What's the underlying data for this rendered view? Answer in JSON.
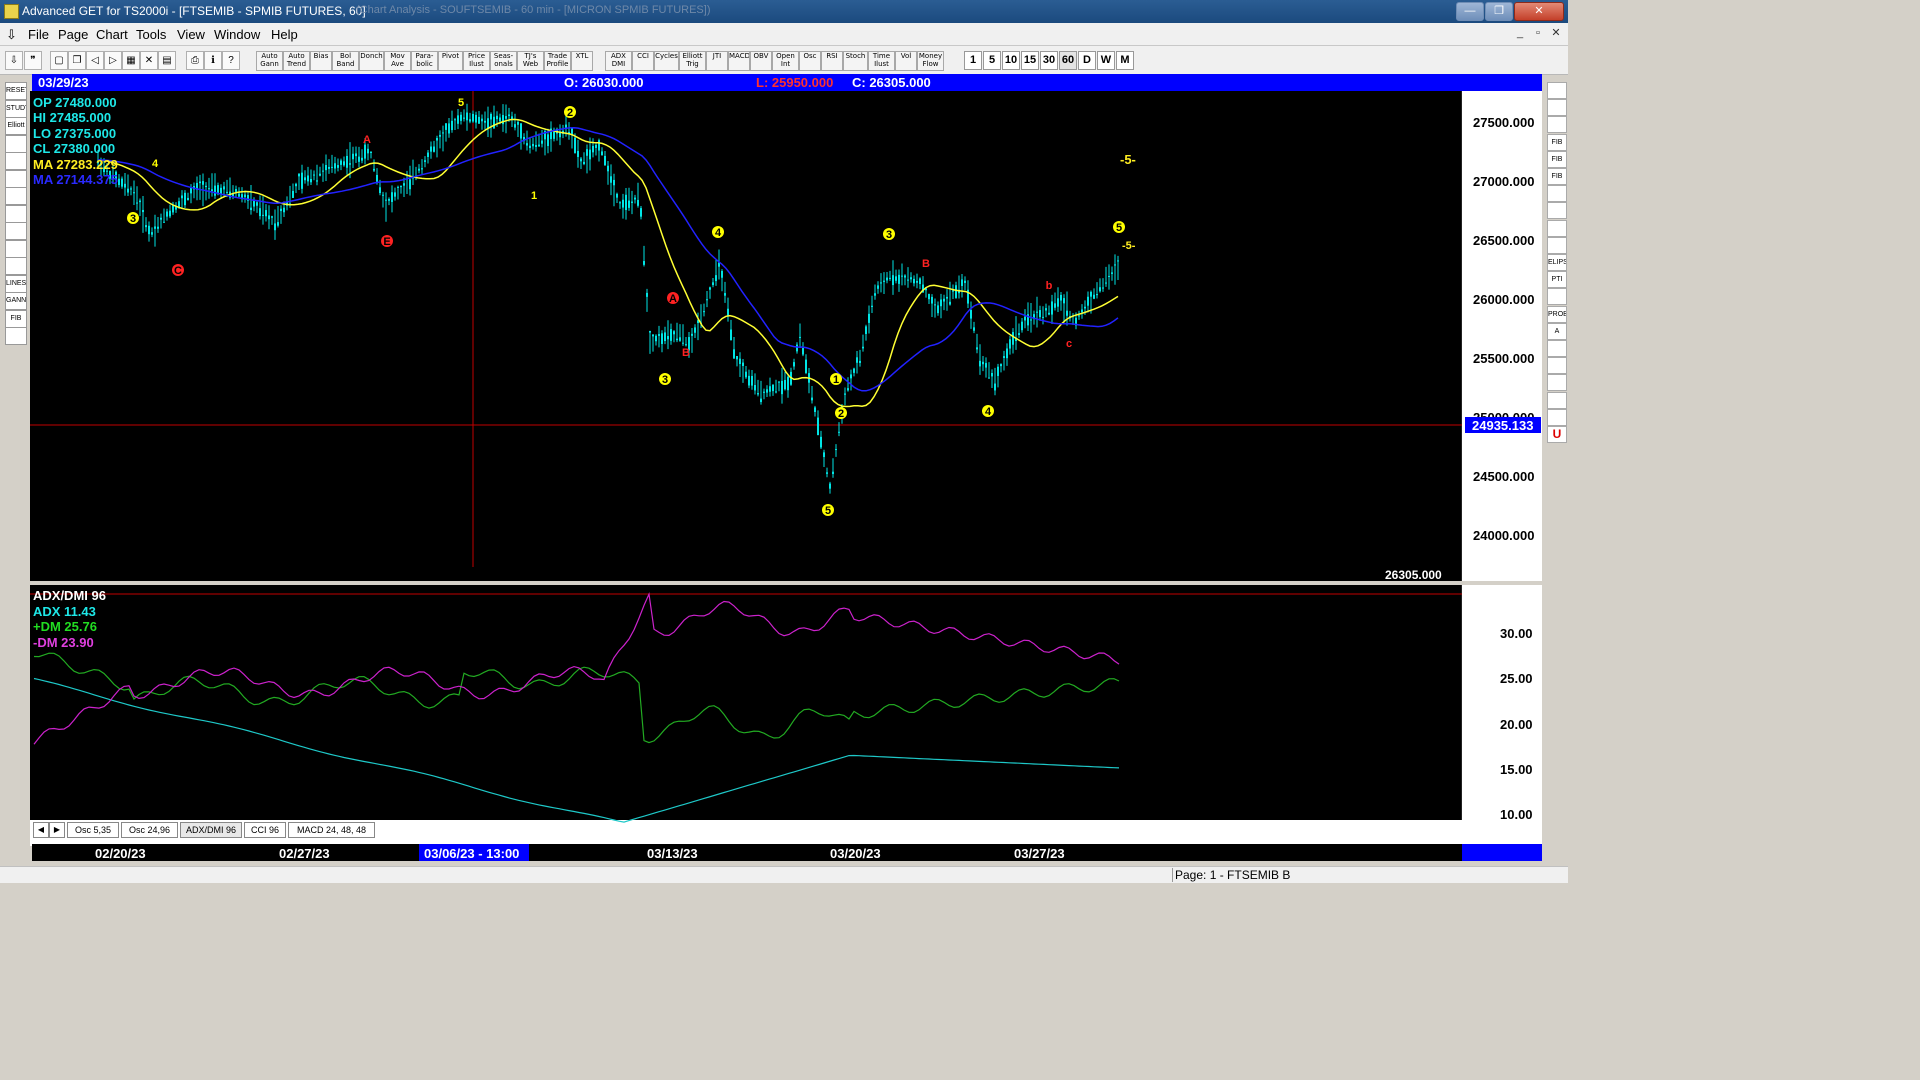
{
  "window": {
    "title": "Advanced GET for TS2000i - [FTSEMIB - SPMIB FUTURES, 60]",
    "ghost_title": "(Chart Analysis - SOUFTSEMIB - 60 min - [MICRON SPMIB FUTURES])",
    "min_label": "—",
    "max_label": "❐",
    "close_label": "✕"
  },
  "menu": [
    "File",
    "Page",
    "Chart",
    "Tools",
    "View",
    "Window",
    "Help"
  ],
  "toolbar": {
    "indicator_buttons": [
      "Auto Gann",
      "Auto Trend",
      "Bias",
      "Bol Band",
      "Donch",
      "Mov Ave",
      "Para-bolic",
      "Pivot",
      "Price Ilust",
      "Seas-onals",
      "TJ's Web",
      "Trade Profile",
      "XTL",
      "ADX DMI",
      "CCI",
      "Cycles",
      "Elliott Trig",
      "JTI",
      "MACD",
      "OBV",
      "Open Int",
      "Osc",
      "RSI",
      "Stoch",
      "Time Ilust",
      "Vol",
      "Money Flow"
    ],
    "timeframes": [
      "1",
      "5",
      "10",
      "15",
      "30",
      "60",
      "D",
      "W",
      "M"
    ]
  },
  "left_tools": [
    "RESET",
    "STUDY",
    "Elliott",
    "",
    "",
    "",
    "",
    "",
    "",
    "",
    "",
    "LINES",
    "GANN",
    "FIB",
    ""
  ],
  "right_tools": [
    "",
    "",
    "",
    "FIB RET",
    "FIB EXT",
    "FIB TIME",
    "",
    "",
    "",
    "",
    "ELIPS",
    "PTI",
    "",
    "PROB",
    "A",
    "",
    "",
    "",
    "",
    "",
    "U"
  ],
  "chart": {
    "date": "03/29/23",
    "open": "O: 26030.000",
    "low": "L:  25950.000",
    "close": "C:  26305.000",
    "info": {
      "op": "OP  27480.000",
      "hi": "HI   27485.000",
      "lo": "LO  27375.000",
      "cl": "CL  27380.000",
      "ma1": "MA  27283.229",
      "ma2": "MA  27144.375"
    },
    "price_axis": [
      "27500.000",
      "27000.000",
      "26500.000",
      "26000.000",
      "25500.000",
      "25000.000",
      "24500.000",
      "24000.000"
    ],
    "cursor_price": "24935.133",
    "last_price": "26305.000",
    "elliott_labels": [
      "-5-",
      "-5-"
    ]
  },
  "indicator": {
    "name": "ADX/DMI 96",
    "adx": "ADX 11.43",
    "pdm": "+DM 25.76",
    "mdm": "-DM  23.90",
    "axis": [
      "30.00",
      "25.00",
      "20.00",
      "15.00",
      "10.00"
    ]
  },
  "tabs": [
    "Osc 5,35",
    "Osc 24,96",
    "ADX/DMI 96",
    "CCI 96",
    "MACD 24, 48, 48"
  ],
  "x_dates": [
    "02/20/23",
    "02/27/23",
    "03/06/23 - 13:00",
    "03/13/23",
    "03/20/23",
    "03/27/23"
  ],
  "status": "Page: 1 - FTSEMIB B",
  "colors": {
    "background": "#000000",
    "bars": "#00e5e5",
    "ma_short": "#ffff33",
    "ma_long": "#2222ff",
    "adx": "#1ec8c8",
    "plus_dm": "#22aa22",
    "minus_dm": "#cc22cc",
    "highlight": "#0000ff"
  }
}
